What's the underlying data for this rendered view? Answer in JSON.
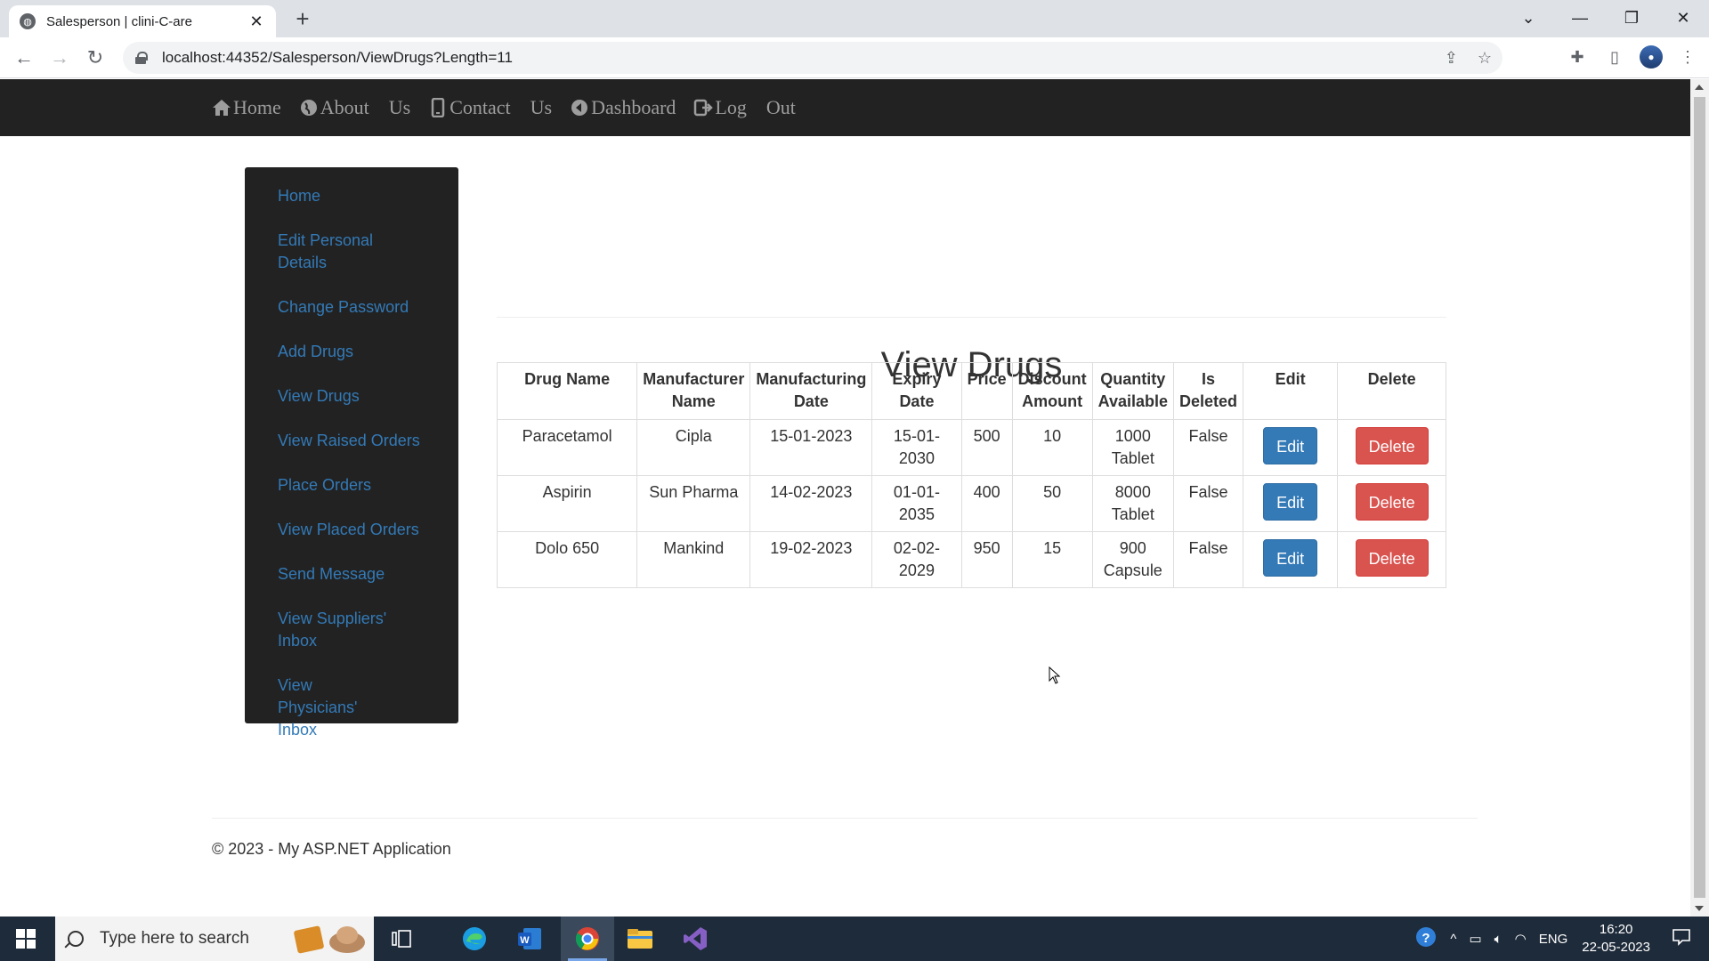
{
  "browser": {
    "tab_title": "Salesperson | clini-C-are",
    "new_tab": "+",
    "url": "localhost:44352/Salesperson/ViewDrugs?Length=11"
  },
  "topnav": {
    "links": [
      {
        "word1": "Home",
        "word2": ""
      },
      {
        "word1": "About",
        "word2": "Us"
      },
      {
        "word1": "Contact",
        "word2": "Us"
      },
      {
        "word1": "Dashboard",
        "word2": ""
      },
      {
        "word1": "Log",
        "word2": "Out"
      }
    ]
  },
  "sidebar": {
    "items": [
      "Home",
      "Edit Personal Details",
      "Change Password",
      "Add Drugs",
      "View Drugs",
      "View Raised Orders",
      "Place Orders",
      "View Placed Orders",
      "Send Message",
      "View Suppliers' Inbox",
      "View Physicians' Inbox"
    ]
  },
  "main": {
    "title": "View Drugs",
    "columns": [
      "Drug Name",
      "Manufacturer Name",
      "Manufacturing Date",
      "Expiry Date",
      "Price",
      "Discount Amount",
      "Quantity Available",
      "Is Deleted",
      "Edit",
      "Delete"
    ],
    "rows": [
      {
        "name": "Paracetamol",
        "manufacturer": "Cipla",
        "mfg_date": "15-01-2023",
        "expiry": "15-01-2030",
        "price": "500",
        "discount": "10",
        "quantity": "1000 Tablet",
        "deleted": "False"
      },
      {
        "name": "Aspirin",
        "manufacturer": "Sun Pharma",
        "mfg_date": "14-02-2023",
        "expiry": "01-01-2035",
        "price": "400",
        "discount": "50",
        "quantity": "8000 Tablet",
        "deleted": "False"
      },
      {
        "name": "Dolo 650",
        "manufacturer": "Mankind",
        "mfg_date": "19-02-2023",
        "expiry": "02-02-2029",
        "price": "950",
        "discount": "15",
        "quantity": "900 Capsule",
        "deleted": "False"
      }
    ],
    "edit_label": "Edit",
    "delete_label": "Delete"
  },
  "footer": {
    "text": "© 2023 - My ASP.NET Application"
  },
  "taskbar": {
    "search_placeholder": "Type here to search",
    "language": "ENG",
    "time": "16:20",
    "date": "22-05-2023"
  }
}
